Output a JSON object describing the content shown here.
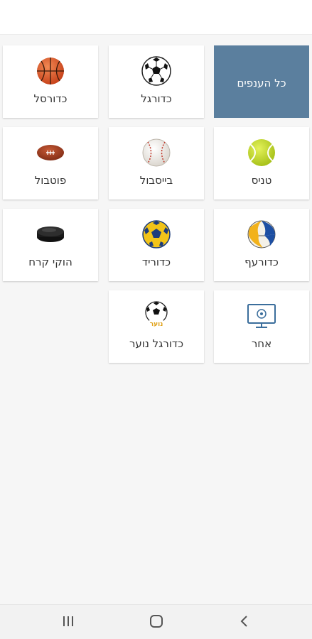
{
  "categories": [
    {
      "id": "all",
      "label": "כל הענפים",
      "icon": "none",
      "selected": true
    },
    {
      "id": "soccer",
      "label": "כדורגל",
      "icon": "soccer-ball-icon"
    },
    {
      "id": "basketball",
      "label": "כדורסל",
      "icon": "basketball-icon"
    },
    {
      "id": "tennis",
      "label": "טניס",
      "icon": "tennis-ball-icon"
    },
    {
      "id": "baseball",
      "label": "בייסבול",
      "icon": "baseball-icon"
    },
    {
      "id": "football",
      "label": "פוטבול",
      "icon": "american-football-icon"
    },
    {
      "id": "volleyball",
      "label": "כדורעף",
      "icon": "volleyball-icon"
    },
    {
      "id": "handball",
      "label": "כדוריד",
      "icon": "handball-icon"
    },
    {
      "id": "ice_hockey",
      "label": "הוקי קרח",
      "icon": "hockey-puck-icon"
    },
    {
      "id": "other",
      "label": "אחר",
      "icon": "tv-screen-icon"
    },
    {
      "id": "youth_soccer",
      "label": "כדורגל נוער",
      "icon": "youth-soccer-icon",
      "badge_text": "נוער"
    }
  ],
  "nav": {
    "recents": "recents-icon",
    "home": "home-icon",
    "back": "back-icon"
  },
  "colors": {
    "selected_tile": "#5b7f9e",
    "background": "#f6f6f6",
    "tile": "#ffffff"
  }
}
